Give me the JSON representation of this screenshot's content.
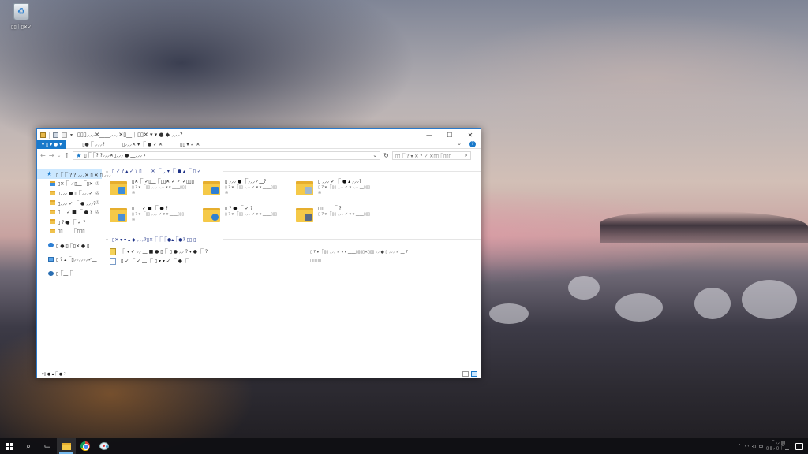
{
  "desktop": {
    "recycle_bin_label": "▯▯⎾▯✕✓"
  },
  "window": {
    "title": "▯▯▯⸝⸝⸝✕⎽⎽⸝⸝⸝✕▯⎽⎾▯▯✕ ▾ ▾ ● ◆ ⸝⸝⸝?",
    "controls": {
      "minimize": "—",
      "maximize": "☐",
      "close": "✕"
    },
    "ribbon_tabs": [
      "▾ ▯ ▾ ● ▾",
      "▯●⎾ ⸝⸝⸝?",
      "▯⸝⸝⸝✕ ▾ ⎾ ● ✓ ✕",
      "▯▯ ▾ ✓ ✕"
    ],
    "address_path": "▯⎾⎾? ?⸝⸝⸝✕▯⸝⸝⸝ ● ⎽⸝⸝⸝ ›",
    "search_placeholder": "▯▯⎾ ? ▾ ✕ ? ✓ ✕▯▯⎾▯▯▯",
    "status_text": "▾▯ ● ▴⎾ ● ?"
  },
  "navpane": {
    "quick_access": "▯⎾⎾ ? ? ⸝⸝⸝✕ ▯ ✕ ▯ ⸝⸝⸝",
    "pinned": [
      "▯✕⎾ ✓▯⎽⎾▯✕",
      "▯⸝⸝⸝ ● ▯⎾⸝⸝⸝✓⎽",
      "▯⸝⸝⸝ ✓ ⎾ ● ⸝⸝⸝?",
      "▯⎽ ✓ ■ ⎾ ● ?",
      "▯ ? ● ⎾ ✓ ?",
      "▯▯⎽⎽⎾▯▯▯"
    ],
    "onedrive": "▯ ● ▯⎾▯✕ ● ▯",
    "this_pc": "▯ ? ▴⎾▯⸝⸝⸝⸝⸝⸝✓⎽",
    "network": "▯⎾⎽⎾"
  },
  "content": {
    "frequent_header": "▯ ✓ ? ▴ ✓ ? ▯⎽⎽✕ ⎾ ⸝ ▾ ⎾ ● ▴ ⎾ ▯ ✓",
    "recent_header": "▯✕ ▾ ▾ ▴ ◆ ⸝⸝⸝?▯✕⎾⎾⎾●▴⎾●? ▯▯ ▯",
    "folders": [
      {
        "name": "▯✕⎾ ✓▯⎽⎾▯▯✕ ✓ ✓ ✓▯▯▯",
        "sub": "▯ ? ▾ ⎾▯▯ ⸝⸝⸝ ⸝⸝⸝ ▾ ▾ ⎽⎽▯▯▯",
        "color": "#3c8ddb"
      },
      {
        "name": "▯ ⸝⸝⸝ ● ⎾⸝⸝⸝✓⎽?",
        "sub": "▯ ? ▾ ⎾▯▯ ⸝⸝⸝ ✓ ▾ ▾ ⎽⎽▯▯▯",
        "color": "#2d7fd4"
      },
      {
        "name": "▯ ⸝⸝⸝ ✓ ⎾ ● ▴ ⸝⸝⸝?",
        "sub": "▯ ? ▾ ⎾▯▯ ⸝⸝⸝ ✓ ▾ ⸝⸝⸝ ⎽▯▯▯",
        "color": "#9fb7cf"
      },
      {
        "name": "▯ ⎽ ✓ ■ ⎾ ● ?",
        "sub": "▯ ? ▾ ⎾▯▯ ⸝⸝⸝ ✓ ▾ ▾ ⎽⎽▯▯▯",
        "color": "#4a8fd6"
      },
      {
        "name": "▯ ? ● ⎾ ✓ ?",
        "sub": "▯ ? ▾ ⎾▯▯ ⸝⸝⸝ ✓ ▾ ▾ ⎽⎽▯▯▯",
        "color": "#2f80d0"
      },
      {
        "name": "▯▯⎽⎽⎾ ?",
        "sub": "▯ ? ▾ ⎾▯▯ ⸝⸝⸝ ✓ ▾ ▾ ⎽⎽▯▯▯",
        "color": "#5a6b85"
      }
    ],
    "recent_files": [
      {
        "name": "⎾ ▾ ✓ ⸝⸝ ⎽ ■ ● ▯⎾ ▯ ● ⸝⸝ ? ▾ ● ⎾ ?",
        "path": "▯ ? ▾ ⎾▯▯ ⸝⸝⸝ ✓ ▾ ▾ ⎽⎽▯▯▯▯✕▯▯▯ ⸝⸝ ● ▯ ⸝⸝⸝ ✓ ⎽ ?"
      },
      {
        "name": "▯ ✓ ⎾ ✓ ⎽ ⎾ ▯ ▾ ▾ ✓ ⎾ ● ⎾",
        "path": "▯▯▯▯▯"
      }
    ]
  },
  "taskbar": {
    "time": "⎾ ⸝⸝ ▯▯",
    "date": "▯ ▯ ⸝ ▯ ⎾ ⎽"
  }
}
